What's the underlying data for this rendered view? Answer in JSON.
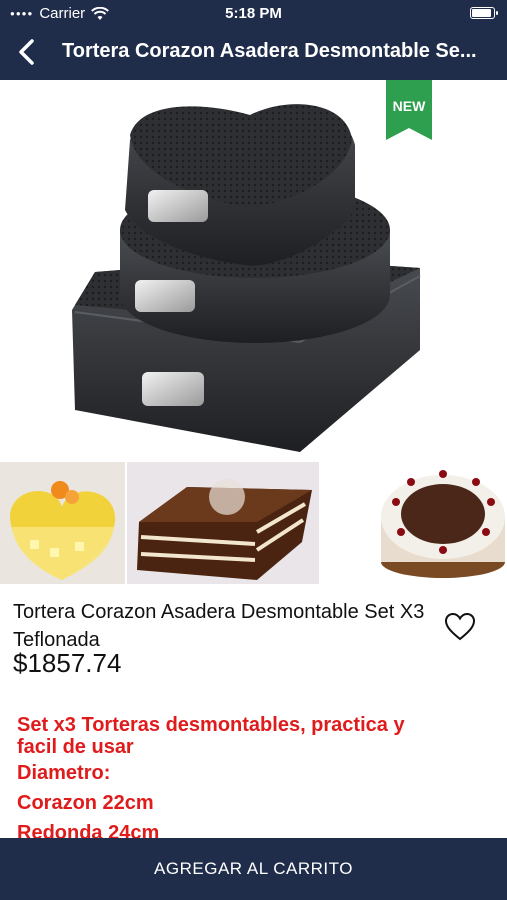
{
  "status_bar": {
    "carrier": "Carrier",
    "time": "5:18 PM",
    "battery_level": 1.0
  },
  "nav": {
    "title": "Tortera Corazon Asadera Desmontable Se...",
    "back_icon": "chevron-left-icon"
  },
  "hero": {
    "badge": "NEW"
  },
  "product": {
    "title": "Tortera Corazon Asadera Desmontable Set X3 Teflonada",
    "price": "$1857.74",
    "favorite_icon": "heart-outline-icon"
  },
  "description": [
    "Set x3 Torteras desmontables, practica y",
    "facil de usar",
    "Diametro:",
    "Corazon 22cm",
    "Redonda 24cm"
  ],
  "footer": {
    "add_to_cart": "AGREGAR AL CARRITO"
  },
  "colors": {
    "primary": "#1f2d4a",
    "accent_red": "#e01b1b",
    "badge_green": "#2e9e4f"
  }
}
